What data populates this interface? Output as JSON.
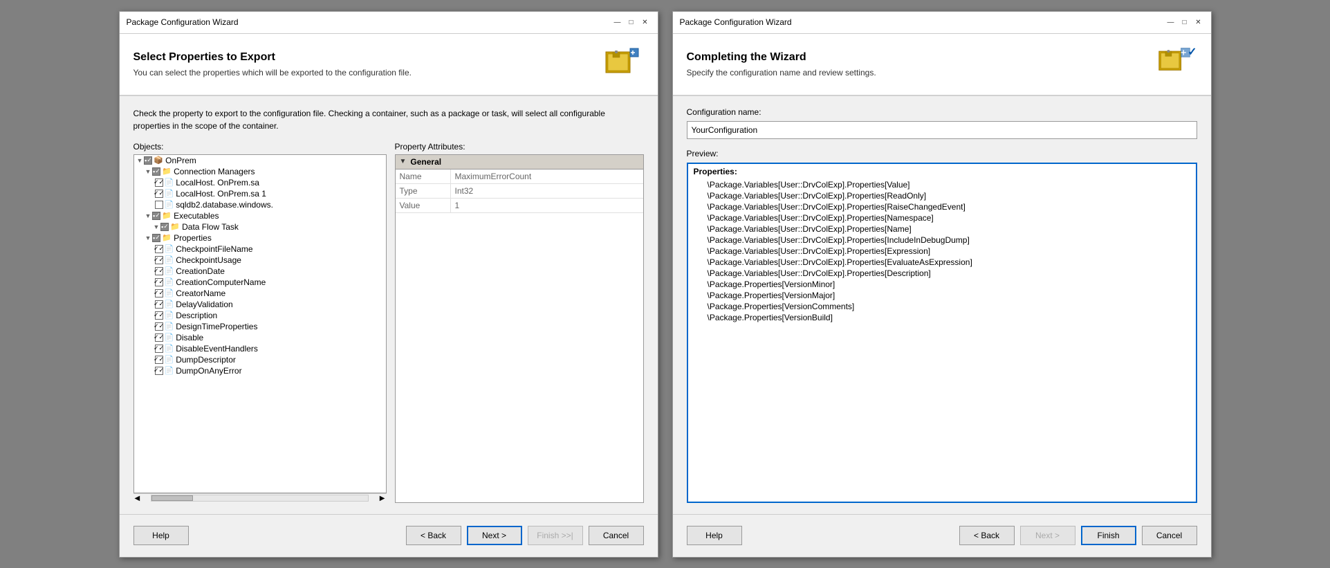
{
  "dialog1": {
    "title": "Package Configuration Wizard",
    "header": {
      "title": "Select Properties to Export",
      "subtitle": "You can select the properties which will be exported to the configuration file."
    },
    "description": "Check the property to export to the configuration file. Checking a container, such as a package or task, will select all configurable properties in the scope of the container.",
    "objects_label": "Objects:",
    "property_label": "Property Attributes:",
    "tree_items": [
      {
        "indent": 0,
        "checked": true,
        "partial": true,
        "expand": true,
        "label": "OnPrem"
      },
      {
        "indent": 1,
        "checked": true,
        "partial": true,
        "expand": true,
        "label": "Connection Managers"
      },
      {
        "indent": 2,
        "checked": true,
        "partial": false,
        "expand": false,
        "label": "LocalHost.          OnPrem.sa"
      },
      {
        "indent": 2,
        "checked": true,
        "partial": false,
        "expand": false,
        "label": "LocalHost.          OnPrem.sa 1"
      },
      {
        "indent": 2,
        "checked": false,
        "partial": false,
        "expand": false,
        "label": "sqldb2.database.windows."
      },
      {
        "indent": 1,
        "checked": true,
        "partial": true,
        "expand": true,
        "label": "Executables"
      },
      {
        "indent": 2,
        "checked": true,
        "partial": true,
        "expand": true,
        "label": "Data Flow Task"
      },
      {
        "indent": 1,
        "checked": true,
        "partial": true,
        "expand": true,
        "label": "Properties"
      },
      {
        "indent": 2,
        "checked": true,
        "partial": false,
        "expand": false,
        "label": "CheckpointFileName"
      },
      {
        "indent": 2,
        "checked": true,
        "partial": false,
        "expand": false,
        "label": "CheckpointUsage"
      },
      {
        "indent": 2,
        "checked": true,
        "partial": false,
        "expand": false,
        "label": "CreationDate"
      },
      {
        "indent": 2,
        "checked": true,
        "partial": false,
        "expand": false,
        "label": "CreationComputerName"
      },
      {
        "indent": 2,
        "checked": true,
        "partial": false,
        "expand": false,
        "label": "CreatorName"
      },
      {
        "indent": 2,
        "checked": true,
        "partial": false,
        "expand": false,
        "label": "DelayValidation"
      },
      {
        "indent": 2,
        "checked": true,
        "partial": false,
        "expand": false,
        "label": "Description"
      },
      {
        "indent": 2,
        "checked": true,
        "partial": false,
        "expand": false,
        "label": "DesignTimeProperties"
      },
      {
        "indent": 2,
        "checked": true,
        "partial": false,
        "expand": false,
        "label": "Disable"
      },
      {
        "indent": 2,
        "checked": true,
        "partial": false,
        "expand": false,
        "label": "DisableEventHandlers"
      },
      {
        "indent": 2,
        "checked": true,
        "partial": false,
        "expand": false,
        "label": "DumpDescriptor"
      },
      {
        "indent": 2,
        "checked": true,
        "partial": false,
        "expand": false,
        "label": "DumpOnAnyError"
      }
    ],
    "property_section_label": "General",
    "properties": [
      {
        "name": "Name",
        "value": "MaximumErrorCount"
      },
      {
        "name": "Type",
        "value": "Int32"
      },
      {
        "name": "Value",
        "value": "1"
      }
    ],
    "buttons": {
      "help": "Help",
      "back": "< Back",
      "next": "Next >",
      "finish": "Finish >>|",
      "cancel": "Cancel"
    }
  },
  "dialog2": {
    "title": "Package Configuration Wizard",
    "header": {
      "title": "Completing the Wizard",
      "subtitle": "Specify the configuration name and review settings."
    },
    "config_name_label": "Configuration name:",
    "config_name_value": "YourConfiguration",
    "preview_label": "Preview:",
    "preview_properties_header": "Properties:",
    "preview_lines": [
      "\\Package.Variables[User::DrvColExp].Properties[Value]",
      "\\Package.Variables[User::DrvColExp].Properties[ReadOnly]",
      "\\Package.Variables[User::DrvColExp].Properties[RaiseChangedEvent]",
      "\\Package.Variables[User::DrvColExp].Properties[Namespace]",
      "\\Package.Variables[User::DrvColExp].Properties[Name]",
      "\\Package.Variables[User::DrvColExp].Properties[IncludeInDebugDump]",
      "\\Package.Variables[User::DrvColExp].Properties[Expression]",
      "\\Package.Variables[User::DrvColExp].Properties[EvaluateAsExpression]",
      "\\Package.Variables[User::DrvColExp].Properties[Description]",
      "\\Package.Properties[VersionMinor]",
      "\\Package.Properties[VersionMajor]",
      "\\Package.Properties[VersionComments]",
      "\\Package.Properties[VersionBuild]"
    ],
    "buttons": {
      "help": "Help",
      "back": "< Back",
      "next": "Next >",
      "finish": "Finish",
      "cancel": "Cancel"
    }
  }
}
